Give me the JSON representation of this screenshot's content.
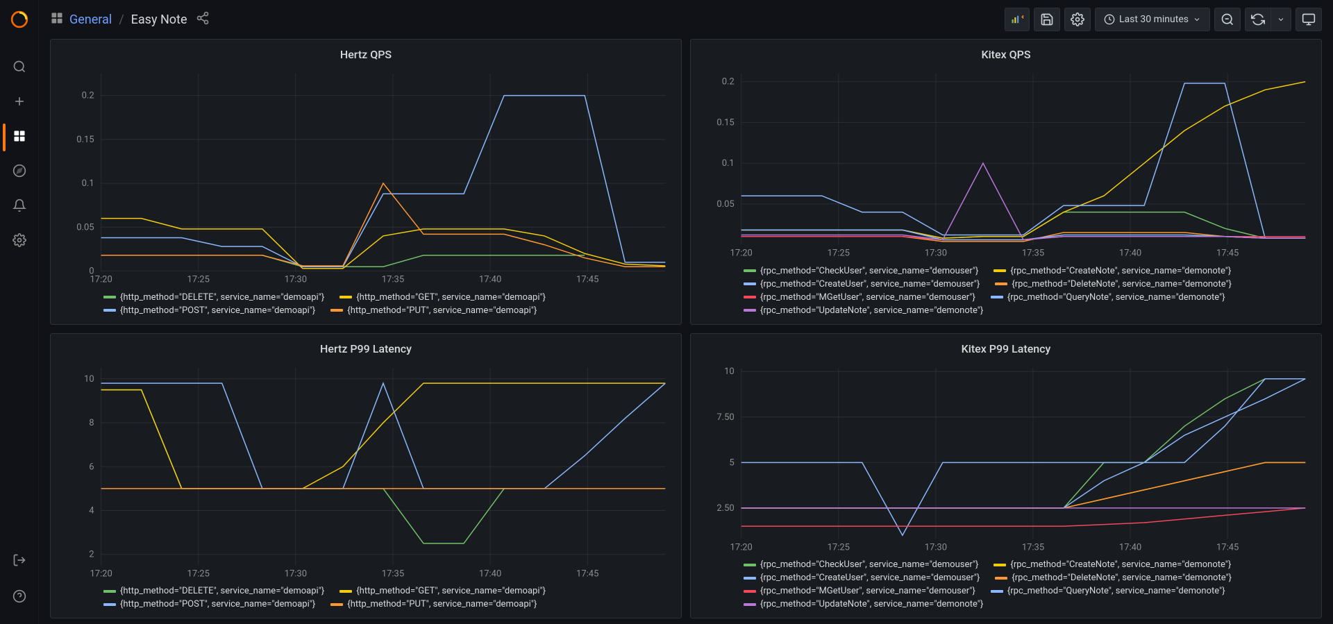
{
  "breadcrumb": {
    "folder": "General",
    "dashboard": "Easy Note"
  },
  "toolbar": {
    "time_label": "Last 30 minutes"
  },
  "sidebar": {
    "items": [
      {
        "icon": "search-icon"
      },
      {
        "icon": "plus-icon"
      },
      {
        "icon": "dashboards-icon",
        "active": true
      },
      {
        "icon": "explore-icon"
      },
      {
        "icon": "bell-icon"
      },
      {
        "icon": "gear-icon"
      }
    ],
    "bottom": [
      {
        "icon": "signin-icon"
      },
      {
        "icon": "help-icon"
      }
    ]
  },
  "colors": {
    "green": "#73BF69",
    "yellow": "#F2CC0C",
    "blue": "#8AB8FF",
    "orange": "#FF9830",
    "red": "#F2495C",
    "purple": "#B877D9"
  },
  "chart_data": [
    {
      "id": "hertz_qps",
      "title": "Hertz QPS",
      "type": "line",
      "xlabel": "",
      "ylabel": "",
      "x_ticks": [
        "17:20",
        "17:25",
        "17:30",
        "17:35",
        "17:40",
        "17:45"
      ],
      "x": [
        0,
        1,
        2,
        3,
        4,
        5,
        6,
        7,
        8,
        9,
        10,
        11,
        12,
        13,
        14
      ],
      "ylim": [
        0,
        0.225
      ],
      "y_ticks": [
        0,
        0.05,
        0.1,
        0.15,
        0.2
      ],
      "series": [
        {
          "name": "{http_method=\"DELETE\", service_name=\"demoapi\"}",
          "color": "green",
          "values": [
            0.018,
            0.018,
            0.018,
            0.018,
            0.018,
            0.005,
            0.005,
            0.005,
            0.018,
            0.018,
            0.018,
            0.018,
            0.018,
            null,
            null
          ]
        },
        {
          "name": "{http_method=\"GET\", service_name=\"demoapi\"}",
          "color": "yellow",
          "values": [
            0.06,
            0.06,
            0.048,
            0.048,
            0.048,
            0.003,
            0.003,
            0.04,
            0.048,
            0.048,
            0.048,
            0.04,
            0.02,
            0.008,
            0.006
          ]
        },
        {
          "name": "{http_method=\"POST\", service_name=\"demoapi\"}",
          "color": "blue",
          "values": [
            0.038,
            0.038,
            0.038,
            0.028,
            0.028,
            0.005,
            0.005,
            0.088,
            0.088,
            0.088,
            0.2,
            0.2,
            0.2,
            0.01,
            0.01
          ]
        },
        {
          "name": "{http_method=\"PUT\", service_name=\"demoapi\"}",
          "color": "orange",
          "values": [
            0.018,
            0.018,
            0.018,
            0.018,
            0.018,
            0.006,
            0.006,
            0.1,
            0.042,
            0.042,
            0.042,
            0.03,
            0.015,
            0.005,
            0.005
          ]
        }
      ]
    },
    {
      "id": "kitex_qps",
      "title": "Kitex QPS",
      "type": "line",
      "xlabel": "",
      "ylabel": "",
      "x_ticks": [
        "17:20",
        "17:25",
        "17:30",
        "17:35",
        "17:40",
        "17:45"
      ],
      "x": [
        0,
        1,
        2,
        3,
        4,
        5,
        6,
        7,
        8,
        9,
        10,
        11,
        12,
        13,
        14
      ],
      "ylim": [
        0,
        0.21
      ],
      "y_ticks": [
        0.05,
        0.1,
        0.15,
        0.2
      ],
      "series": [
        {
          "name": "{rpc_method=\"CheckUser\", service_name=\"demouser\"}",
          "color": "green",
          "values": [
            0.018,
            0.018,
            0.018,
            0.018,
            0.018,
            0.008,
            0.01,
            0.01,
            0.04,
            0.04,
            0.04,
            0.04,
            0.02,
            0.008,
            0.008
          ]
        },
        {
          "name": "{rpc_method=\"CreateNote\", service_name=\"demonote\"}",
          "color": "yellow",
          "values": [
            0.018,
            0.018,
            0.018,
            0.018,
            0.018,
            0.008,
            0.01,
            0.01,
            0.04,
            0.06,
            0.1,
            0.14,
            0.17,
            0.19,
            0.2
          ]
        },
        {
          "name": "{rpc_method=\"CreateUser\", service_name=\"demouser\"}",
          "color": "blue",
          "values": [
            0.06,
            0.06,
            0.06,
            0.04,
            0.04,
            0.012,
            0.012,
            0.012,
            0.048,
            0.048,
            0.048,
            0.198,
            0.198,
            0.008,
            0.008
          ]
        },
        {
          "name": "{rpc_method=\"DeleteNote\", service_name=\"demonote\"}",
          "color": "orange",
          "values": [
            0.01,
            0.01,
            0.01,
            0.01,
            0.01,
            0.004,
            0.004,
            0.004,
            0.015,
            0.015,
            0.015,
            0.015,
            0.01,
            0.008,
            0.008
          ]
        },
        {
          "name": "{rpc_method=\"MGetUser\", service_name=\"demouser\"}",
          "color": "red",
          "values": [
            0.01,
            0.01,
            0.01,
            0.01,
            0.01,
            0.006,
            0.006,
            0.006,
            0.01,
            0.01,
            0.01,
            0.01,
            0.01,
            0.01,
            0.01
          ]
        },
        {
          "name": "{rpc_method=\"QueryNote\", service_name=\"demonote\"}",
          "color": "blue",
          "values": [
            0.018,
            0.018,
            0.018,
            0.018,
            0.018,
            0.006,
            0.006,
            0.006,
            0.012,
            0.012,
            0.012,
            0.012,
            0.01,
            0.008,
            0.008
          ]
        },
        {
          "name": "{rpc_method=\"UpdateNote\", service_name=\"demonote\"}",
          "color": "purple",
          "values": [
            0.012,
            0.012,
            0.012,
            0.012,
            0.012,
            0.006,
            0.1,
            0.006,
            0.01,
            0.01,
            0.01,
            0.01,
            0.01,
            0.008,
            0.008
          ]
        }
      ]
    },
    {
      "id": "hertz_p99",
      "title": "Hertz P99 Latency",
      "type": "line",
      "xlabel": "",
      "ylabel": "",
      "x_ticks": [
        "17:20",
        "17:25",
        "17:30",
        "17:35",
        "17:40",
        "17:45"
      ],
      "x": [
        0,
        1,
        2,
        3,
        4,
        5,
        6,
        7,
        8,
        9,
        10,
        11,
        12,
        13,
        14
      ],
      "ylim": [
        1.5,
        10.5
      ],
      "y_ticks": [
        2,
        4,
        6,
        8,
        10
      ],
      "series": [
        {
          "name": "{http_method=\"DELETE\", service_name=\"demoapi\"}",
          "color": "green",
          "values": [
            9.5,
            9.5,
            5.0,
            5.0,
            5.0,
            5.0,
            5.0,
            5.0,
            2.5,
            2.5,
            5.0,
            null,
            null,
            null,
            null
          ]
        },
        {
          "name": "{http_method=\"GET\", service_name=\"demoapi\"}",
          "color": "yellow",
          "values": [
            9.5,
            9.5,
            5.0,
            5.0,
            5.0,
            5.0,
            6.0,
            8.0,
            9.8,
            9.8,
            9.8,
            9.8,
            9.8,
            9.8,
            9.8
          ]
        },
        {
          "name": "{http_method=\"POST\", service_name=\"demoapi\"}",
          "color": "blue",
          "values": [
            9.8,
            9.8,
            9.8,
            9.8,
            5.0,
            5.0,
            5.0,
            9.8,
            5.0,
            5.0,
            5.0,
            5.0,
            6.5,
            8.2,
            9.8
          ]
        },
        {
          "name": "{http_method=\"PUT\", service_name=\"demoapi\"}",
          "color": "orange",
          "values": [
            5.0,
            5.0,
            5.0,
            5.0,
            5.0,
            5.0,
            5.0,
            5.0,
            5.0,
            5.0,
            5.0,
            5.0,
            5.0,
            5.0,
            5.0
          ]
        }
      ]
    },
    {
      "id": "kitex_p99",
      "title": "Kitex P99 Latency",
      "type": "line",
      "xlabel": "",
      "ylabel": "",
      "x_ticks": [
        "17:20",
        "17:25",
        "17:30",
        "17:35",
        "17:40",
        "17:45"
      ],
      "x": [
        0,
        1,
        2,
        3,
        4,
        5,
        6,
        7,
        8,
        9,
        10,
        11,
        12,
        13,
        14
      ],
      "ylim": [
        0.8,
        10.2
      ],
      "y_ticks": [
        2.5,
        5,
        7.5,
        10
      ],
      "series": [
        {
          "name": "{rpc_method=\"CheckUser\", service_name=\"demouser\"}",
          "color": "green",
          "values": [
            2.5,
            2.5,
            2.5,
            2.5,
            2.5,
            2.5,
            2.5,
            2.5,
            2.5,
            5.0,
            5.0,
            7.0,
            8.5,
            9.6,
            9.6
          ]
        },
        {
          "name": "{rpc_method=\"CreateNote\", service_name=\"demonote\"}",
          "color": "yellow",
          "values": [
            2.5,
            2.5,
            2.5,
            2.5,
            2.5,
            2.5,
            2.5,
            2.5,
            2.5,
            3.0,
            3.5,
            4.0,
            4.5,
            5.0,
            5.0
          ]
        },
        {
          "name": "{rpc_method=\"CreateUser\", service_name=\"demouser\"}",
          "color": "blue",
          "values": [
            5.0,
            5.0,
            5.0,
            5.0,
            1.0,
            5.0,
            5.0,
            5.0,
            5.0,
            5.0,
            5.0,
            5.0,
            7.0,
            9.6,
            9.6
          ]
        },
        {
          "name": "{rpc_method=\"DeleteNote\", service_name=\"demonote\"}",
          "color": "orange",
          "values": [
            2.5,
            2.5,
            2.5,
            2.5,
            2.5,
            2.5,
            2.5,
            2.5,
            2.5,
            3.0,
            3.5,
            4.0,
            4.5,
            5.0,
            5.0
          ]
        },
        {
          "name": "{rpc_method=\"MGetUser\", service_name=\"demouser\"}",
          "color": "red",
          "values": [
            1.5,
            1.5,
            1.5,
            1.5,
            1.5,
            1.5,
            1.5,
            1.5,
            1.5,
            1.6,
            1.7,
            1.9,
            2.1,
            2.3,
            2.5
          ]
        },
        {
          "name": "{rpc_method=\"QueryNote\", service_name=\"demonote\"}",
          "color": "blue",
          "values": [
            2.5,
            2.5,
            2.5,
            2.5,
            2.5,
            2.5,
            2.5,
            2.5,
            2.5,
            4.0,
            5.0,
            6.5,
            7.5,
            8.5,
            9.6
          ]
        },
        {
          "name": "{rpc_method=\"UpdateNote\", service_name=\"demonote\"}",
          "color": "purple",
          "values": [
            2.5,
            2.5,
            2.5,
            2.5,
            2.5,
            2.5,
            2.5,
            2.5,
            2.5,
            2.5,
            2.5,
            2.5,
            2.5,
            2.5,
            2.5
          ]
        }
      ]
    }
  ]
}
